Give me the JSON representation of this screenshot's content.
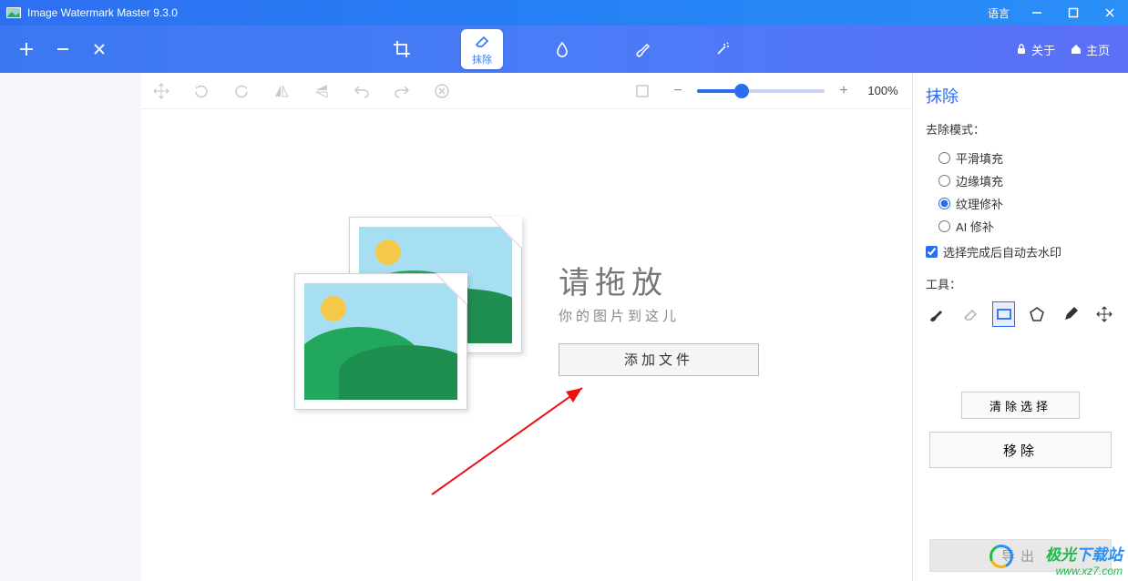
{
  "title_bar": {
    "app_title": "Image Watermark Master 9.3.0",
    "language_label": "语言"
  },
  "top_nav": {
    "modes": {
      "crop": "",
      "erase": "抹除",
      "drop": "",
      "brush": "",
      "wand": ""
    },
    "about": "关于",
    "home": "主页"
  },
  "canvas_toolbar": {
    "zoom_pct": "100%"
  },
  "drop_zone": {
    "title": "请拖放",
    "subtitle": "你的图片到这儿",
    "add_file": "添加文件"
  },
  "side": {
    "heading": "抹除",
    "mode_label": "去除模式：",
    "radios": {
      "smooth": "平滑填充",
      "edge": "边缘填充",
      "texture": "纹理修补",
      "ai": "AI 修补"
    },
    "auto_checkbox": "选择完成后自动去水印",
    "tools_label": "工具：",
    "clear_btn": "清除选择",
    "remove_btn": "移除"
  },
  "export_btn": "导出",
  "watermark": {
    "line1a": "极光",
    "line1b": "下载站",
    "line2": "www.xz7.com"
  }
}
